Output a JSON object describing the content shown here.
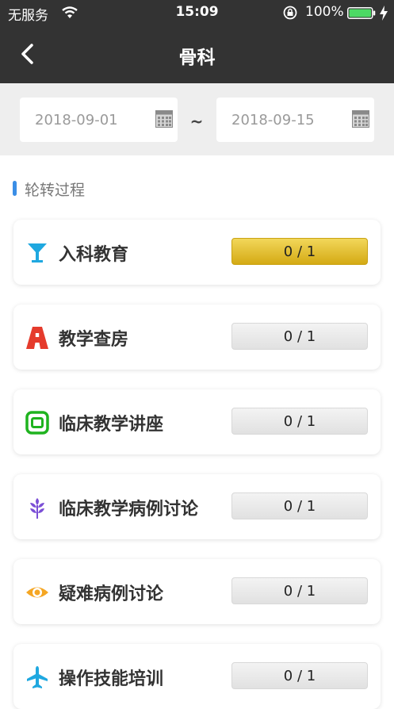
{
  "status_bar": {
    "carrier": "无服务",
    "time": "15:09",
    "battery": "100%"
  },
  "header": {
    "title": "骨科"
  },
  "date_filter": {
    "start_date": "2018-09-01",
    "separator": "~",
    "end_date": "2018-09-15"
  },
  "section": {
    "title": "轮转过程",
    "accent_color": "#3a8ee6"
  },
  "items": [
    {
      "label": "入科教育",
      "progress": "0 / 1",
      "icon": "cocktail-icon",
      "icon_color": "#1fa8e0",
      "highlighted": true
    },
    {
      "label": "教学查房",
      "progress": "0 / 1",
      "icon": "road-icon",
      "icon_color": "#e53b2c",
      "highlighted": false
    },
    {
      "label": "临床教学讲座",
      "progress": "0 / 1",
      "icon": "screen-icon",
      "icon_color": "#1fb31f",
      "highlighted": false
    },
    {
      "label": "临床教学病例讨论",
      "progress": "0 / 1",
      "icon": "wheat-icon",
      "icon_color": "#7b4fd6",
      "highlighted": false
    },
    {
      "label": "疑难病例讨论",
      "progress": "0 / 1",
      "icon": "eye-icon",
      "icon_color": "#f5a623",
      "highlighted": false
    },
    {
      "label": "操作技能培训",
      "progress": "0 / 1",
      "icon": "airplane-icon",
      "icon_color": "#1fa8e0",
      "highlighted": false
    }
  ]
}
